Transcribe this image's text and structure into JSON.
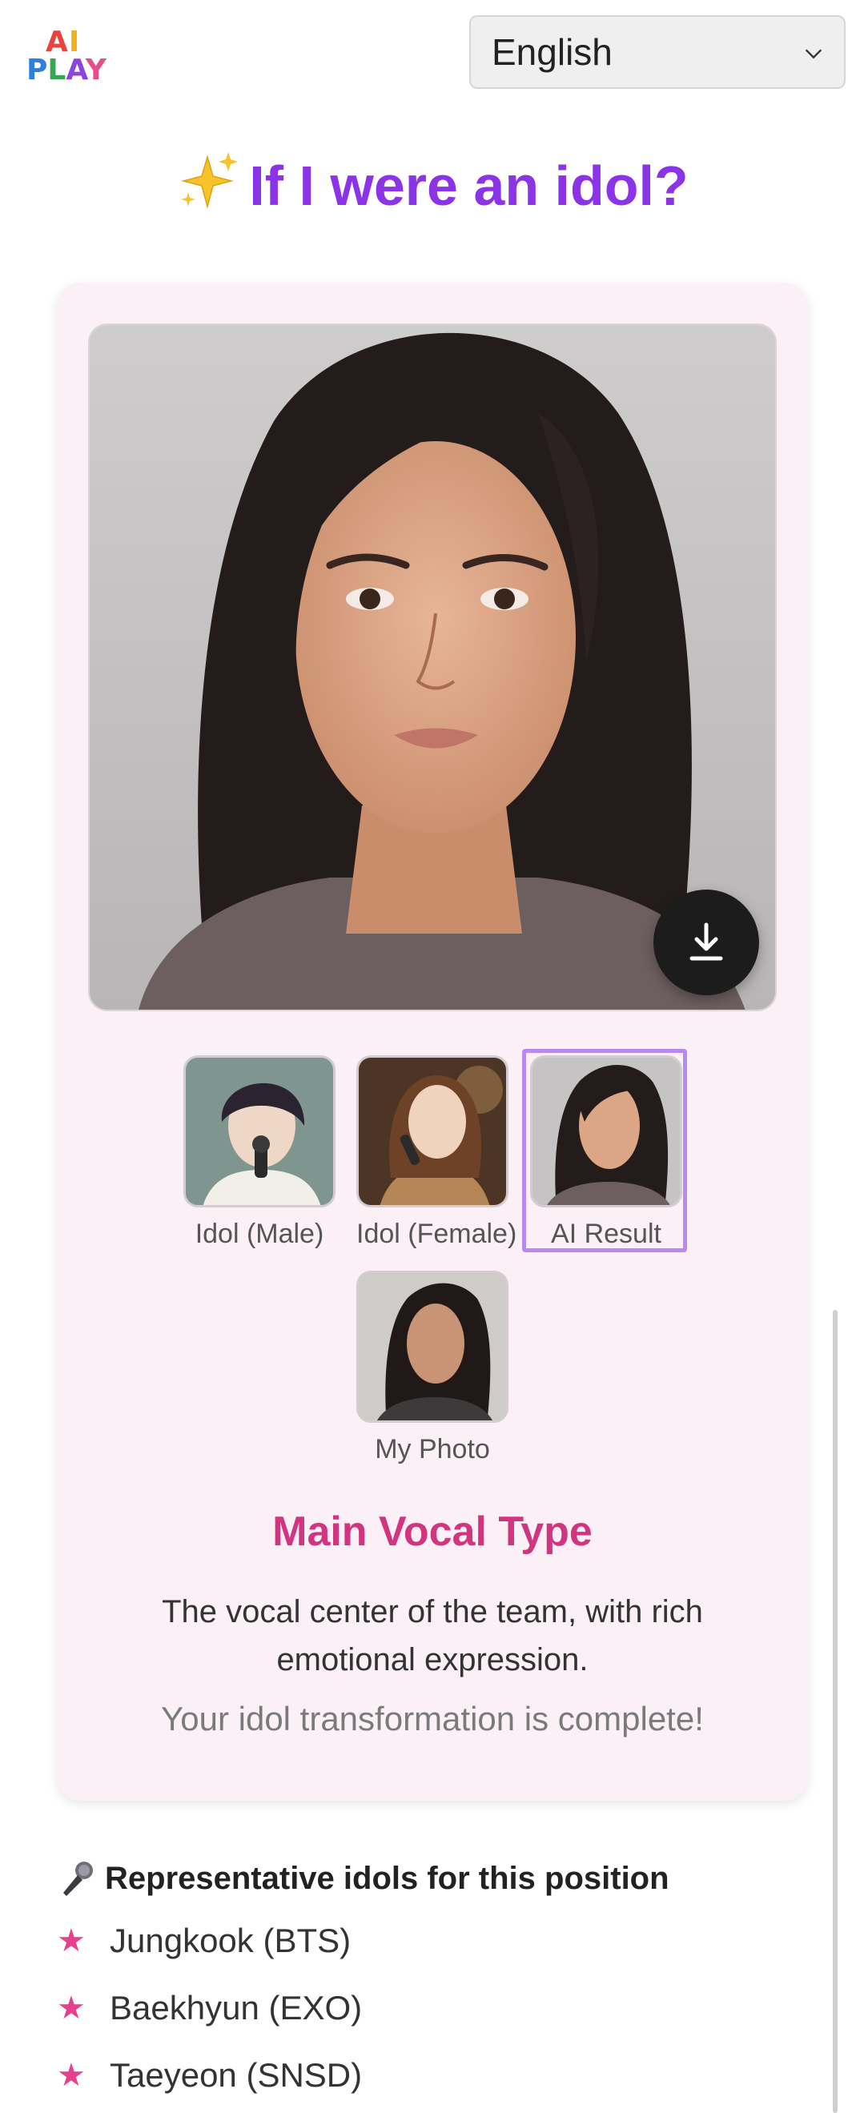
{
  "header": {
    "logo_line1": "AI",
    "logo_line2": "PLAY",
    "language": "English"
  },
  "title": "If I were an idol?",
  "thumbnails": [
    {
      "label": "Idol (Male)"
    },
    {
      "label": "Idol (Female)"
    },
    {
      "label": "AI Result",
      "selected": true
    },
    {
      "label": "My Photo"
    }
  ],
  "result": {
    "type_title": "Main Vocal Type",
    "description": "The vocal center of the team, with rich emotional expression.",
    "complete_message": "Your idol transformation is complete!"
  },
  "representatives": {
    "title": "Representative idols for this position",
    "items": [
      "Jungkook (BTS)",
      "Baekhyun (EXO)",
      "Taeyeon (SNSD)"
    ]
  },
  "icons": {
    "sparkle": "sparkles-icon",
    "download": "download-icon",
    "mic": "microphone-icon",
    "star": "star-icon"
  }
}
